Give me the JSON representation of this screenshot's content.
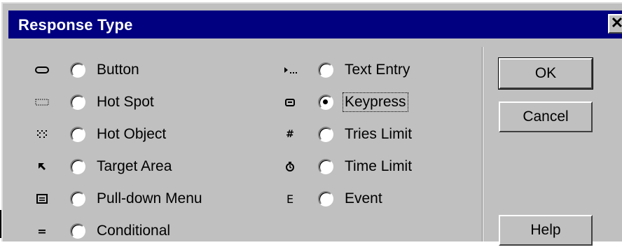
{
  "dialog": {
    "title": "Response Type",
    "close_glyph": "✕"
  },
  "options_left": [
    {
      "label": "Button",
      "icon": "button-icon",
      "checked": false
    },
    {
      "label": "Hot Spot",
      "icon": "hot-spot-icon",
      "checked": false
    },
    {
      "label": "Hot Object",
      "icon": "hot-object-icon",
      "checked": false
    },
    {
      "label": "Target Area",
      "icon": "target-area-icon",
      "checked": false
    },
    {
      "label": "Pull-down Menu",
      "icon": "pull-down-menu-icon",
      "checked": false
    },
    {
      "label": "Conditional",
      "icon": "conditional-icon",
      "checked": false
    }
  ],
  "options_right": [
    {
      "label": "Text Entry",
      "icon": "text-entry-icon",
      "checked": false
    },
    {
      "label": "Keypress",
      "icon": "keypress-icon",
      "checked": true
    },
    {
      "label": "Tries Limit",
      "icon": "tries-limit-icon",
      "checked": false
    },
    {
      "label": "Time Limit",
      "icon": "time-limit-icon",
      "checked": false
    },
    {
      "label": "Event",
      "icon": "event-icon",
      "checked": false
    }
  ],
  "icons": {
    "tries_limit": "#",
    "event": "E",
    "conditional": "="
  },
  "buttons": {
    "ok": "OK",
    "cancel": "Cancel",
    "help": "Help"
  },
  "colors": {
    "face": "#c0c0c0",
    "titlebar": "#000080",
    "title_text": "#ffffff"
  }
}
